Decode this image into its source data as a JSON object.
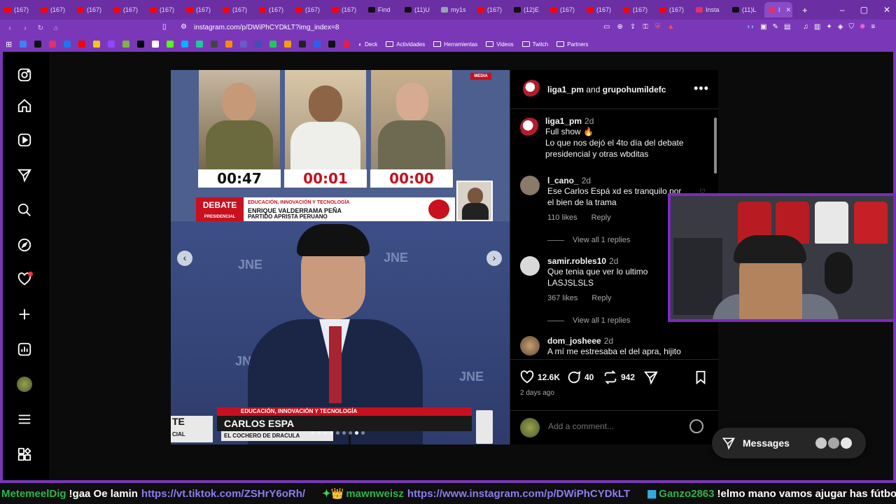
{
  "browser": {
    "tabs": [
      {
        "label": "(167)",
        "icon": "youtube-icon"
      },
      {
        "label": "(167)",
        "icon": "youtube-icon"
      },
      {
        "label": "(167)",
        "icon": "youtube-icon"
      },
      {
        "label": "(167)",
        "icon": "youtube-icon"
      },
      {
        "label": "(167)",
        "icon": "youtube-icon"
      },
      {
        "label": "(167)",
        "icon": "youtube-icon"
      },
      {
        "label": "(167)",
        "icon": "youtube-icon"
      },
      {
        "label": "(167)",
        "icon": "youtube-icon"
      },
      {
        "label": "(167)",
        "icon": "youtube-icon"
      },
      {
        "label": "(167)",
        "icon": "youtube-icon"
      },
      {
        "label": "Find",
        "icon": "tiktok-icon"
      },
      {
        "label": "(11)U",
        "icon": "tiktok-icon"
      },
      {
        "label": "my1s",
        "icon": "globe-icon"
      },
      {
        "label": "(167)",
        "icon": "youtube-icon"
      },
      {
        "label": "(12)E",
        "icon": "tiktok-icon"
      },
      {
        "label": "(167)",
        "icon": "youtube-icon"
      },
      {
        "label": "(167)",
        "icon": "youtube-icon"
      },
      {
        "label": "(167)",
        "icon": "youtube-icon"
      },
      {
        "label": "(167)",
        "icon": "youtube-icon"
      },
      {
        "label": "Insta",
        "icon": "instagram-icon"
      },
      {
        "label": "(11)L",
        "icon": "tiktok-icon"
      }
    ],
    "active_tab": {
      "label": "I"
    },
    "new_tab": "+",
    "url": "instagram.com/p/DWiPhCYDkLT?img_index=8",
    "bookmarks": [
      "Deck",
      "Actividades",
      "Herramientas",
      "Videos",
      "Twitch",
      "Partners"
    ]
  },
  "post": {
    "header": {
      "user1": "liga1_pm",
      "and": "and",
      "user2": "grupohumildefc",
      "more": "•••"
    },
    "media": {
      "timers": [
        "00:47",
        "00:01",
        "00:00"
      ],
      "debate_logo": "DEBATE",
      "debate_logo_sub": "PRESIDENCIAL",
      "debate_topic": "EDUCACIÓN, INNOVACIÓN Y TECNOLOGÍA",
      "debate_candidate": "ENRIQUE VALDERRAMA PEÑA",
      "debate_party": "PARTIDO APRISTA PERUANO",
      "media_badge": "MEDIA",
      "watermark": "JNE",
      "lower_topic": "EDUCACIÓN, INNOVACIÓN Y TECNOLOGÍA",
      "lower_name": "CARLOS ESPA",
      "lower_sub": "EL COCHERO DE DRACULA",
      "lower_left_1": "TE",
      "lower_left_2": "CIAL",
      "prev_label": "‹",
      "next_label": "›",
      "slide_count": 9,
      "current_slide": 8
    },
    "caption": {
      "user": "liga1_pm",
      "time": "2d",
      "line1": "Full show 🔥",
      "line2": "Lo que nos dejó el 4to día del debate presidencial y otras wbditas"
    },
    "comments": [
      {
        "user": "l_cano_",
        "time": "2d",
        "text": "Ese Carlos Espá xd es tranquilo por el bien de la trama",
        "likes": "110 likes",
        "reply": "Reply",
        "replies": "View all 1 replies"
      },
      {
        "user": "samir.robles10",
        "time": "2d",
        "text": "Que tenia que ver lo ultimo LASJSLSLS",
        "likes": "367 likes",
        "reply": "Reply",
        "replies": "View all 1 replies"
      },
      {
        "user": "dom_josheee",
        "time": "2d",
        "text": "A mí me estresaba el del apra, hijito"
      }
    ],
    "actions": {
      "likes": "12.6K",
      "comments": "40",
      "reposts": "942"
    },
    "posted": "2 days ago",
    "add_comment_placeholder": "Add a comment..."
  },
  "messages": {
    "label": "Messages"
  },
  "ticker": [
    {
      "user": "MetemeelDig",
      "msg": "!gaa Oe lamin",
      "link": "https://vt.tiktok.com/ZSHrY6oRh/"
    },
    {
      "badge": "✦👑",
      "user": "mawnweisz",
      "link": "https://www.instagram.com/p/DWiPhCYDkLT"
    },
    {
      "badge": "▦",
      "user": "Ganzo2863",
      "msg": "!elmo mano vamos ajugar has fútbol"
    }
  ],
  "colors": {
    "browser": "#7a38b8",
    "tabbar": "#6b2fa3",
    "link": "#8c7cf2",
    "chat_user": "#2fb44b",
    "like_red": "#ff3040"
  }
}
